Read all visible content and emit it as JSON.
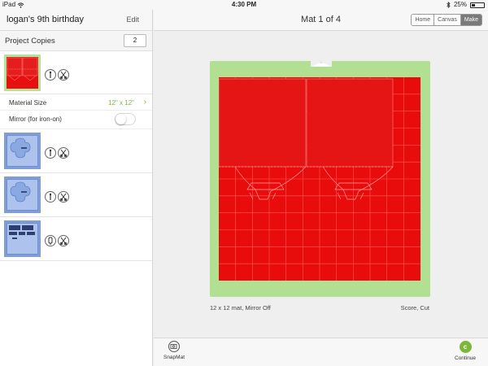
{
  "status": {
    "device": "iPad",
    "time": "4:30 PM",
    "battery": "25%",
    "battery_fraction": 0.25
  },
  "sidebar": {
    "title": "logan's 9th birthday",
    "edit_label": "Edit",
    "copies_label": "Project Copies",
    "copies_value": "2",
    "material_label": "Material Size",
    "material_value": "12\" x 12\"",
    "mirror_label": "Mirror (for iron-on)",
    "mirror_on": false
  },
  "header": {
    "title": "Mat 1 of 4",
    "tabs": [
      "Home",
      "Canvas",
      "Make"
    ],
    "active_tab": "Make"
  },
  "mat": {
    "caption": "12 x 12 mat, Mirror Off",
    "operations": "Score, Cut",
    "thumb_label": "Score",
    "thumb_label_2": "Cut"
  },
  "footer": {
    "snapmat_label": "SnapMat",
    "continue_label": "Continue",
    "continue_icon": "c"
  },
  "colors": {
    "accent": "#7bb83a",
    "mat_green": "#b2e093",
    "material_red": "#e80c0c",
    "material_blue": "#adc3ee"
  }
}
